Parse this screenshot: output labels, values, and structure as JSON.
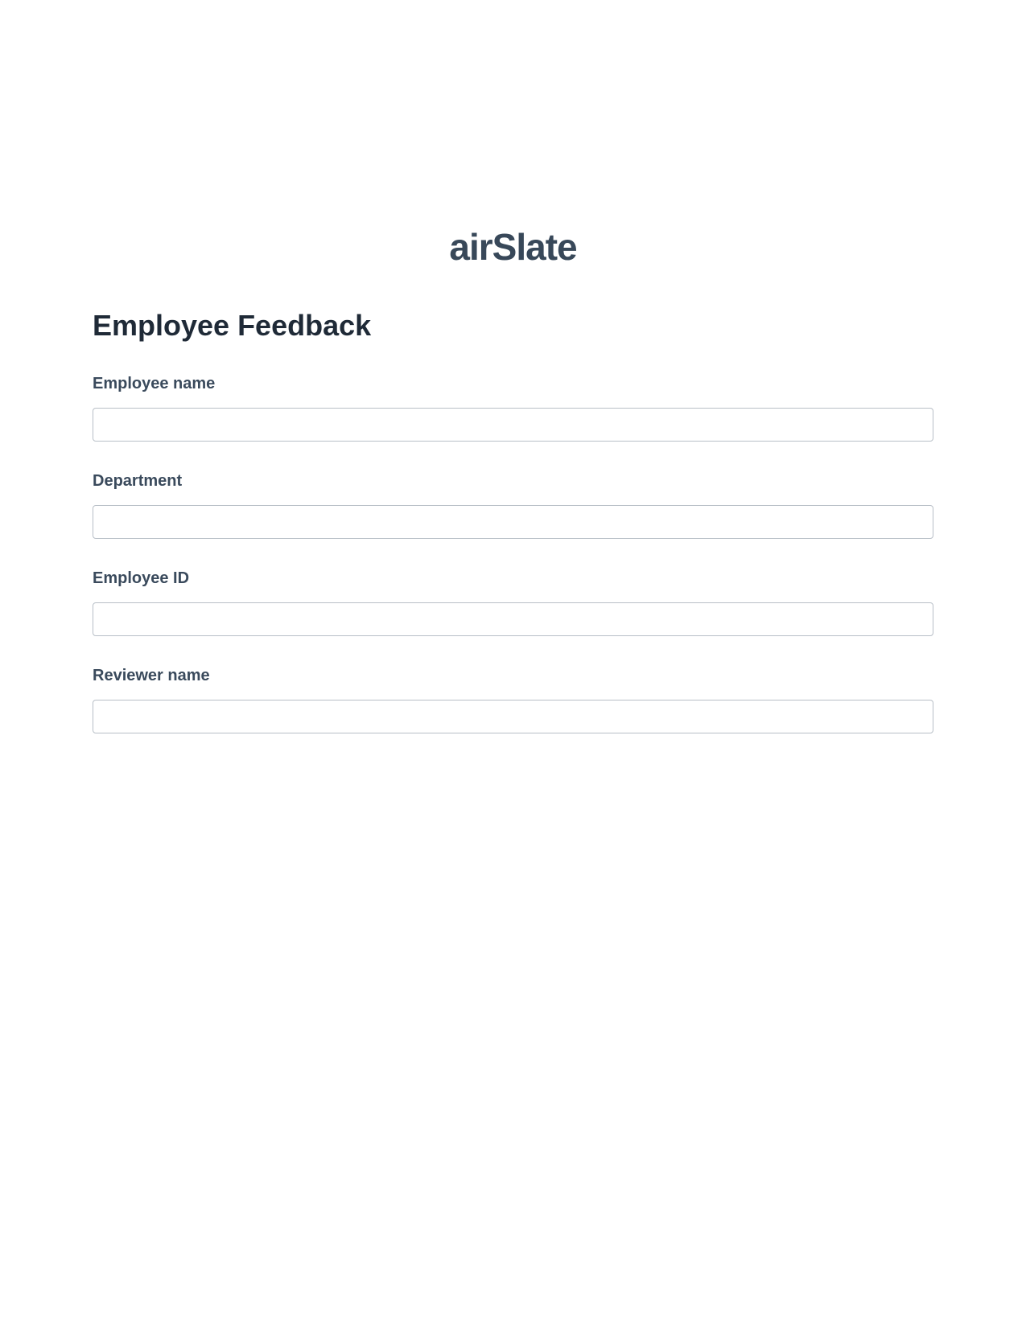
{
  "logo": {
    "text_prefix": "air",
    "text_suffix": "Slate"
  },
  "form": {
    "title": "Employee Feedback",
    "fields": [
      {
        "label": "Employee name",
        "value": ""
      },
      {
        "label": "Department",
        "value": ""
      },
      {
        "label": "Employee ID",
        "value": ""
      },
      {
        "label": "Reviewer name",
        "value": ""
      }
    ]
  }
}
